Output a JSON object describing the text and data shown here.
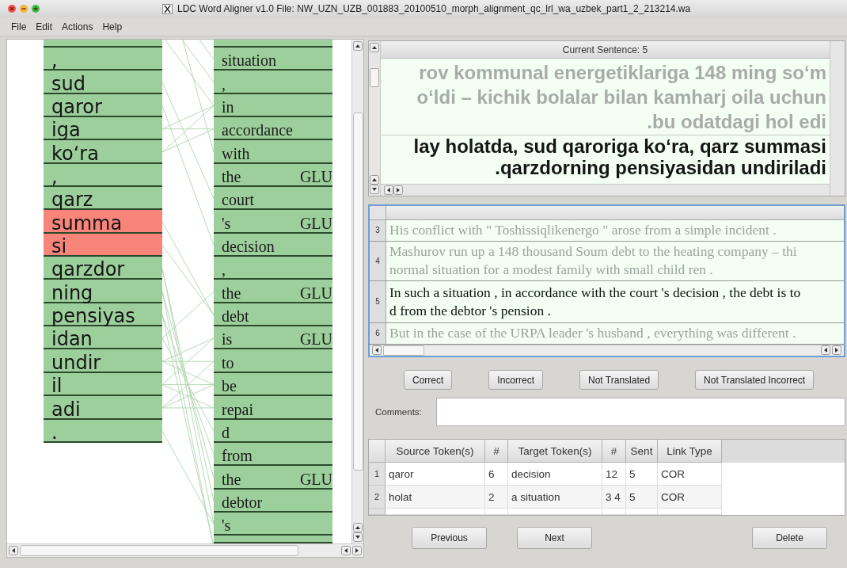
{
  "window": {
    "title": "LDC Word Aligner v1.0  File: NW_UZN_UZB_001883_20100510_morph_alignment_qc_lrl_wa_uzbek_part1_2_213214.wa"
  },
  "menu": [
    "File",
    "Edit",
    "Actions",
    "Help"
  ],
  "source_tokens": [
    {
      "text": ",",
      "selected": false
    },
    {
      "text": "sud",
      "selected": false
    },
    {
      "text": "qaror",
      "selected": false
    },
    {
      "text": "iga",
      "selected": false
    },
    {
      "text": "ko‘ra",
      "selected": false
    },
    {
      "text": ",",
      "selected": false
    },
    {
      "text": "qarz",
      "selected": false
    },
    {
      "text": "summa",
      "selected": true
    },
    {
      "text": "si",
      "selected": true
    },
    {
      "text": "qarzdor",
      "selected": false
    },
    {
      "text": "ning",
      "selected": false
    },
    {
      "text": "pensiyas",
      "selected": false
    },
    {
      "text": "idan",
      "selected": false
    },
    {
      "text": "undir",
      "selected": false
    },
    {
      "text": "il",
      "selected": false
    },
    {
      "text": "adi",
      "selected": false
    },
    {
      "text": ".",
      "selected": false
    }
  ],
  "target_tokens": [
    {
      "text": "situation"
    },
    {
      "text": ","
    },
    {
      "text": "in"
    },
    {
      "text": "accordance"
    },
    {
      "text": "with"
    },
    {
      "text": "the",
      "tag": "GLU"
    },
    {
      "text": "court"
    },
    {
      "text": "'s",
      "tag": "GLU"
    },
    {
      "text": "decision"
    },
    {
      "text": ","
    },
    {
      "text": "the",
      "tag": "GLU"
    },
    {
      "text": "debt"
    },
    {
      "text": "is",
      "tag": "GLU"
    },
    {
      "text": "to"
    },
    {
      "text": "be"
    },
    {
      "text": "repai"
    },
    {
      "text": "d"
    },
    {
      "text": "from"
    },
    {
      "text": "the",
      "tag": "GLU"
    },
    {
      "text": "debtor"
    },
    {
      "text": "'s"
    }
  ],
  "sentence_view": {
    "header": "Current Sentence: 5",
    "lines": [
      {
        "text": "rov kommunal energetiklariga 148 ming so‘m",
        "current": false
      },
      {
        "text": "o‘ldi – kichik bolalar bilan kamharj oila uchun",
        "current": false
      },
      {
        "text": ".bu odatdagi hol edi",
        "current": false
      },
      {
        "text": "lay holatda, sud qaroriga ko‘ra, qarz summasi",
        "current": true
      },
      {
        "text": ".qarzdorning pensiyasidan undiriladi",
        "current": true
      }
    ]
  },
  "sentences": [
    {
      "number": "3",
      "lines": [
        "His conflict with \" Toshissiqlikenergo \" arose from a simple incident ."
      ],
      "current": false
    },
    {
      "number": "4",
      "lines": [
        "Mashurov run up a 148 thousand Soum debt to the heating company – thi",
        "normal situation for a modest family with small child ren ."
      ],
      "current": false
    },
    {
      "number": "5",
      "lines": [
        "In such a situation , in accordance with the court 's decision , the debt is to",
        "d from the debtor 's pension ."
      ],
      "current": true
    },
    {
      "number": "6",
      "lines": [
        "But in the case of the URPA leader 's husband , everything was different ."
      ],
      "current": false
    }
  ],
  "judgement_buttons": [
    "Correct",
    "Incorrect",
    "Not Translated",
    "Not Translated Incorrect"
  ],
  "comments": {
    "label": "Comments:"
  },
  "links_table": {
    "columns": [
      "Source Token(s)",
      "#",
      "Target Token(s)",
      "#",
      "Sent",
      "Link Type"
    ],
    "rows": [
      {
        "number": "1",
        "cells": [
          "qaror",
          "6",
          "decision",
          "12",
          "5",
          "COR"
        ]
      },
      {
        "number": "2",
        "cells": [
          "holat",
          "2",
          "a situation",
          "3 4",
          "5",
          "COR"
        ]
      }
    ]
  },
  "nav_buttons": [
    "Previous",
    "Next",
    "Delete"
  ]
}
